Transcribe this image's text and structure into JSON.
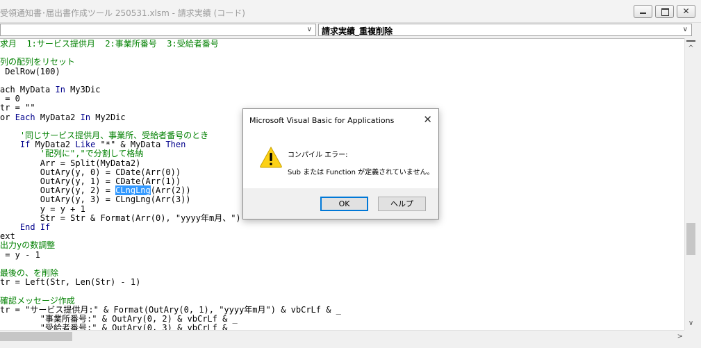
{
  "window": {
    "title": "受領通知書･届出書作成ツール 250531.xlsm - 請求実績 (コード)",
    "minimize_icon": "minimize-icon",
    "maximize_icon": "maximize-icon",
    "close_glyph": "✕"
  },
  "combos": {
    "object_value": "",
    "procedure_value": "請求実績_重複削除",
    "arrow_glyph": "∨"
  },
  "code": {
    "lines": [
      {
        "text": "求月  1:サービス提供月  2:事業所番号  3:受給者番号",
        "style": "comment"
      },
      {
        "text": "",
        "style": "normal"
      },
      {
        "text": "列の配列をリセット",
        "style": "comment"
      },
      {
        "text": " DelRow(100)",
        "style": "normal"
      },
      {
        "text": "",
        "style": "normal"
      },
      {
        "text": "ach MyData In My3Dic",
        "style": "normal"
      },
      {
        "text": " = 0",
        "style": "normal"
      },
      {
        "text": "tr = \"\"",
        "style": "normal"
      },
      {
        "text": "or Each MyData2 In My2Dic",
        "style": "normal"
      },
      {
        "text": "",
        "style": "normal"
      },
      {
        "text": "    '同じサービス提供月、事業所、受給者番号のとき",
        "style": "comment"
      },
      {
        "text": "    If MyData2 Like \"*\" & MyData Then",
        "style": "normal"
      },
      {
        "text": "        '配列に\",\"で分割して格納",
        "style": "comment"
      },
      {
        "text": "        Arr = Split(MyData2)",
        "style": "normal"
      },
      {
        "text": "        OutAry(y, 0) = CDate(Arr(0))",
        "style": "normal"
      },
      {
        "text": "        OutAry(y, 1) = CDate(Arr(1))",
        "style": "normal"
      },
      {
        "text": "        OutAry(y, 2) = CLngLng(Arr(2))",
        "style": "normal"
      },
      {
        "text": "        OutAry(y, 3) = CLngLng(Arr(3))",
        "style": "normal"
      },
      {
        "text": "        y = y + 1",
        "style": "normal"
      },
      {
        "text": "        Str = Str & Format(Arr(0), \"yyyy年m月、\")",
        "style": "normal"
      },
      {
        "text": "    End If",
        "style": "normal"
      },
      {
        "text": "ext",
        "style": "normal"
      },
      {
        "text": "出力yの数調整",
        "style": "comment"
      },
      {
        "text": " = y - 1",
        "style": "normal"
      },
      {
        "text": "",
        "style": "normal"
      },
      {
        "text": "最後の、を削除",
        "style": "comment"
      },
      {
        "text": "tr = Left(Str, Len(Str) - 1)",
        "style": "normal"
      },
      {
        "text": "",
        "style": "normal"
      },
      {
        "text": "確認メッセージ作成",
        "style": "comment"
      },
      {
        "text": "tr = \"サービス提供月:\" & Format(OutAry(0, 1), \"yyyy年m月\") & vbCrLf & _",
        "style": "normal"
      },
      {
        "text": "        \"事業所番号:\" & OutAry(0, 2) & vbCrLf & _",
        "style": "normal"
      },
      {
        "text": "        \"受給者番号:\" & OutAry(0, 3) & vbCrLf & _",
        "style": "normal"
      }
    ],
    "selected_word": "CLngLng",
    "keyword_color": "#00008b",
    "comment_color": "#008000",
    "selection_color": "#3399ff"
  },
  "scrollbars": {
    "up_glyph": "^",
    "down_glyph": "∨",
    "right_glyph": ">"
  },
  "dialog": {
    "title": "Microsoft Visual Basic for Applications",
    "close_glyph": "✕",
    "icon": "warning-icon",
    "message_title": "コンパイル エラー:",
    "message_body": "Sub または Function が定義されていません。",
    "ok_label": "OK",
    "help_label": "ヘルプ"
  }
}
